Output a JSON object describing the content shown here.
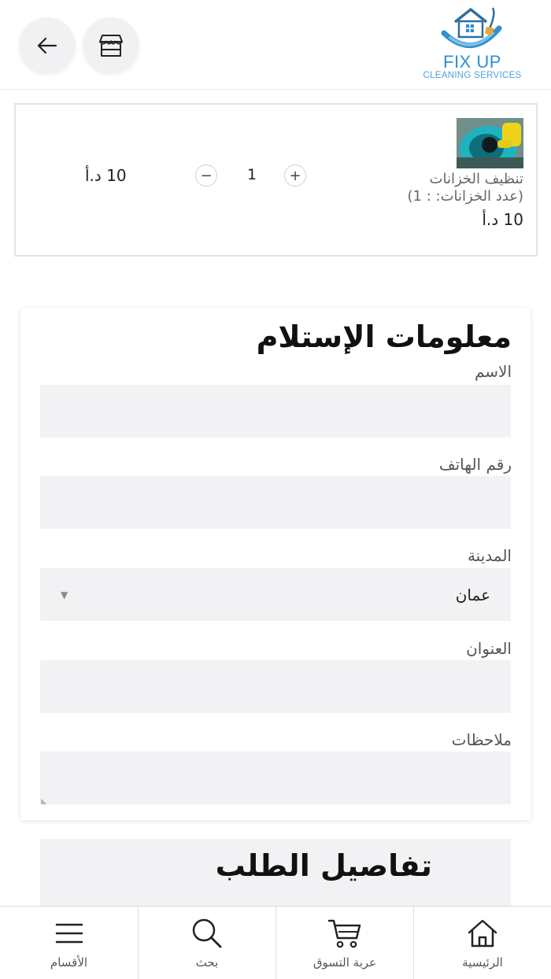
{
  "header": {
    "logo": {
      "title": "FIX UP",
      "subtitle": "CLEANING SERVICES"
    },
    "back_icon": "arrow-left-icon",
    "store_icon": "store-icon"
  },
  "cart": {
    "item": {
      "name": "تنظيف الخزانات",
      "option": "(عدد الخزانات: : 1)",
      "price": "10 د.أ",
      "quantity": "1",
      "line_total": "10 د.أ"
    }
  },
  "delivery_form": {
    "title": "معلومات الإستلام",
    "fields": {
      "name": {
        "label": "الاسم",
        "value": ""
      },
      "phone": {
        "label": "رقم الهاتف",
        "value": ""
      },
      "city": {
        "label": "المدينة",
        "value": "عمان"
      },
      "address": {
        "label": "العنوان",
        "value": ""
      },
      "notes": {
        "label": "ملاحظات",
        "value": ""
      }
    }
  },
  "order_details": {
    "title": "تفاصيل الطلب"
  },
  "bottom_nav": {
    "items": [
      {
        "label": "الأقسام",
        "icon": "menu-icon"
      },
      {
        "label": "بحث",
        "icon": "search-icon"
      },
      {
        "label": "عربة التسوق",
        "icon": "cart-icon"
      },
      {
        "label": "الرئيسية",
        "icon": "home-icon"
      }
    ]
  },
  "colors": {
    "brand": "#2f8fd0",
    "input_bg": "#f2f2f5",
    "border": "#e4e4e4"
  }
}
